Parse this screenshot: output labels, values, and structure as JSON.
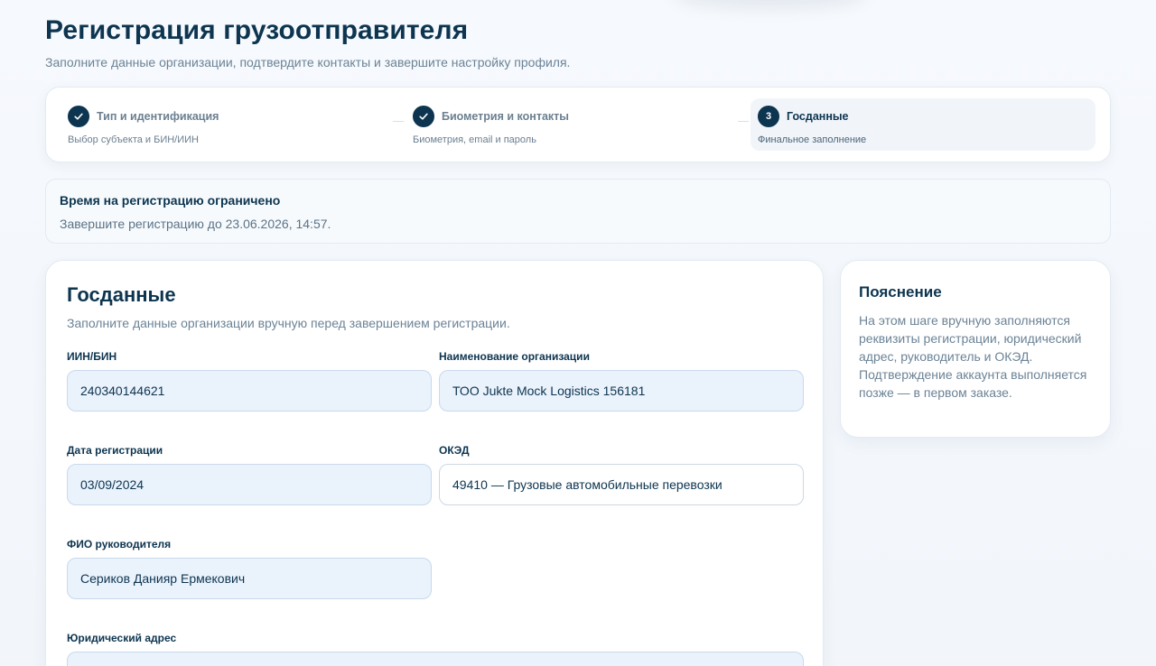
{
  "header": {
    "title": "Регистрация грузоотправителя",
    "subtitle": "Заполните данные организации, подтвердите контакты и завершите настройку профиля."
  },
  "stepper": {
    "steps": [
      {
        "number": "1",
        "icon": "check-icon",
        "title": "Тип и идентификация",
        "subtitle": "Выбор субъекта и БИН/ИИН",
        "state": "done"
      },
      {
        "number": "2",
        "icon": "check-icon",
        "title": "Биометрия и контакты",
        "subtitle": "Биометрия, email и пароль",
        "state": "done"
      },
      {
        "number": "3",
        "title": "Госданные",
        "subtitle": "Финальное заполнение",
        "state": "active"
      }
    ]
  },
  "notice": {
    "title": "Время на регистрацию ограничено",
    "text": "Завершите регистрацию до 23.06.2026, 14:57."
  },
  "form": {
    "title": "Госданные",
    "description": "Заполните данные организации вручную перед завершением регистрации.",
    "fields": {
      "iin_bin": {
        "label": "ИИН/БИН",
        "value": "240340144621"
      },
      "org_name": {
        "label": "Наименование организации",
        "value": "ТОО Jukte Mock Logistics 156181"
      },
      "reg_date": {
        "label": "Дата регистрации",
        "value": "03/09/2024"
      },
      "oked": {
        "label": "ОКЭД",
        "value": "49410 — Грузовые автомобильные перевозки"
      },
      "director": {
        "label": "ФИО руководителя",
        "value": "Сериков Данияр Ермекович"
      },
      "legal_address": {
        "label": "Юридический адрес",
        "value": ""
      }
    }
  },
  "side": {
    "title": "Пояснение",
    "text": "На этом шаге вручную заполняются реквизиты регистрации, юридический адрес, руководитель и ОКЭД. Подтверждение аккаунта выполняется позже — в первом заказе."
  },
  "colors": {
    "primary": "#0d3550",
    "muted": "#6b8396",
    "input_fill": "#eaf2fc",
    "input_border": "#c9d9ec"
  }
}
